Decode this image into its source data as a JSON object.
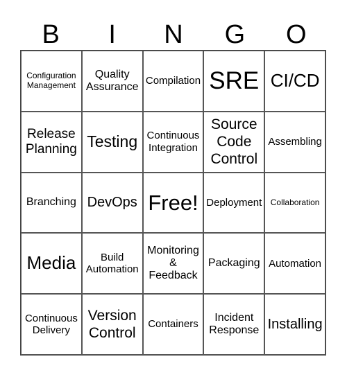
{
  "header": [
    "B",
    "I",
    "N",
    "G",
    "O"
  ],
  "cells": [
    "Configuration\nManagement",
    "Quality\nAssurance",
    "Compilation",
    "SRE",
    "CI/CD",
    "Release\nPlanning",
    "Testing",
    "Continuous\nIntegration",
    "Source\nCode\nControl",
    "Assembling",
    "Branching",
    "DevOps",
    "Free!",
    "Deployment",
    "Collaboration",
    "Media",
    "Build\nAutomation",
    "Monitoring\n&\nFeedback",
    "Packaging",
    "Automation",
    "Continuous\nDelivery",
    "Version\nControl",
    "Containers",
    "Incident\nResponse",
    "Installing"
  ]
}
